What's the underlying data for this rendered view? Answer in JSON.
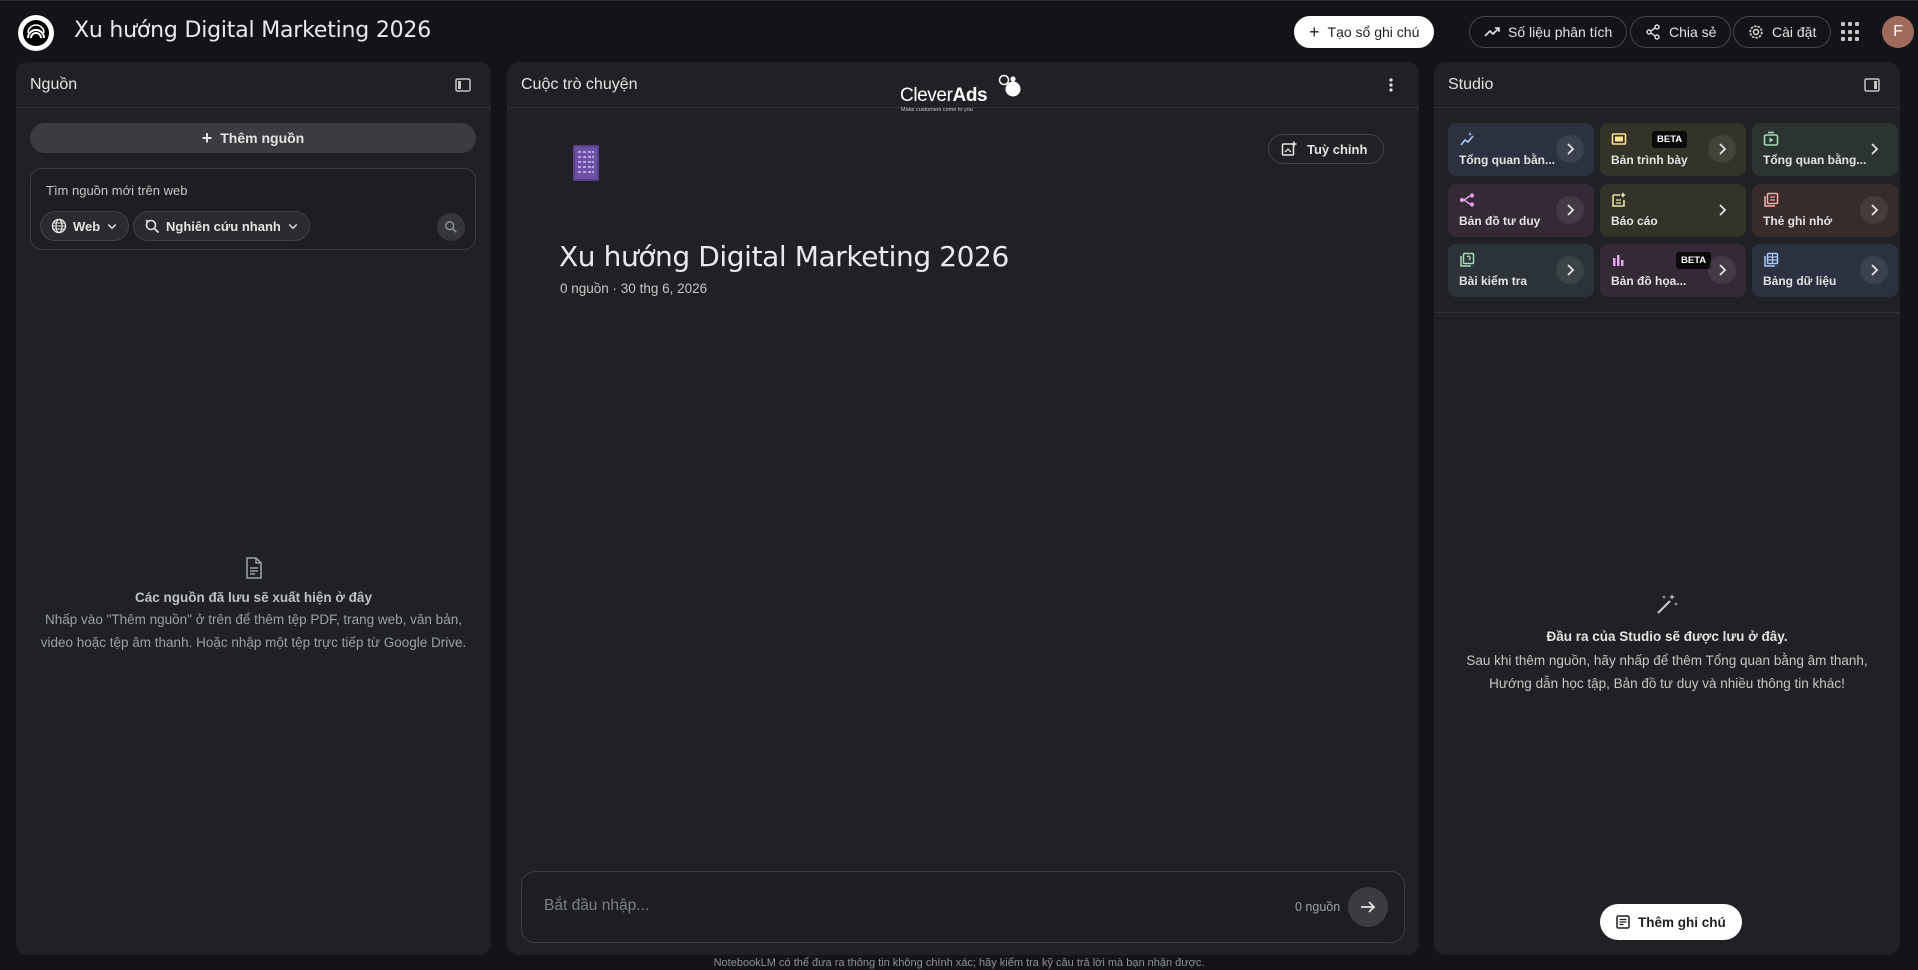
{
  "header": {
    "notebook_title": "Xu hướng Digital Marketing 2026",
    "create_notebook": "Tạo sổ ghi chú",
    "analytics": "Số liệu phân tích",
    "share": "Chia sẻ",
    "settings": "Cài đặt",
    "avatar_initial": "F"
  },
  "sources": {
    "title": "Nguồn",
    "add_source": "Thêm nguồn",
    "web_search_label": "Tìm nguồn mới trên web",
    "chip_web": "Web",
    "chip_research": "Nghiên cứu nhanh",
    "empty_title": "Các nguồn đã lưu sẽ xuất hiện ở đây",
    "empty_desc": "Nhấp vào \"Thêm nguồn\" ở trên để thêm tệp PDF, trang web, văn bản, video hoặc tệp âm thanh. Hoặc nhập một tệp trực tiếp từ Google Drive."
  },
  "chat": {
    "title": "Cuộc trò chuyện",
    "watermark_brand_light": "Clever",
    "watermark_brand_bold": "Ads",
    "watermark_tagline": "Make customers come to you",
    "customize": "Tuỳ chỉnh",
    "notebook_title": "Xu hướng Digital Marketing 2026",
    "meta": "0 nguồn · 30 thg 6, 2026",
    "placeholder": "Bắt đầu nhập...",
    "source_count": "0 nguồn"
  },
  "studio": {
    "title": "Studio",
    "tiles": [
      {
        "label": "Tổng quan bằn...",
        "icon": "sparkle-wave-icon",
        "beta": ""
      },
      {
        "label": "Bản trình bày",
        "icon": "slides-icon",
        "beta": "BETA"
      },
      {
        "label": "Tổng quan bằng...",
        "icon": "video-overview-icon",
        "beta": ""
      },
      {
        "label": "Bản đồ tư duy",
        "icon": "mind-map-icon",
        "beta": ""
      },
      {
        "label": "Báo cáo",
        "icon": "report-icon",
        "beta": ""
      },
      {
        "label": "Thẻ ghi nhớ",
        "icon": "flashcards-icon",
        "beta": ""
      },
      {
        "label": "Bài kiểm tra",
        "icon": "quiz-icon",
        "beta": ""
      },
      {
        "label": "Bản đồ họa...",
        "icon": "infographic-icon",
        "beta": "BETA"
      },
      {
        "label": "Bảng dữ liệu",
        "icon": "data-table-icon",
        "beta": ""
      }
    ],
    "empty_title": "Đầu ra của Studio sẽ được lưu ở đây.",
    "empty_desc": "Sau khi thêm nguồn, hãy nhấp để thêm Tổng quan bằng âm thanh, Hướng dẫn học tập, Bản đồ tư duy và nhiều thông tin khác!",
    "add_note": "Thêm ghi chú"
  },
  "disclaimer": "NotebookLM có thể đưa ra thông tin không chính xác; hãy kiểm tra kỹ câu trả lời mà bạn nhận được.",
  "colors": {
    "background": "#131417",
    "panel": "#202124",
    "tile_blue": "#2b313f",
    "tile_yellow": "#34332a",
    "tile_green": "#2b3430",
    "tile_purple": "#342a36",
    "tile_olive": "#33332a",
    "tile_rose": "#382b2c"
  }
}
